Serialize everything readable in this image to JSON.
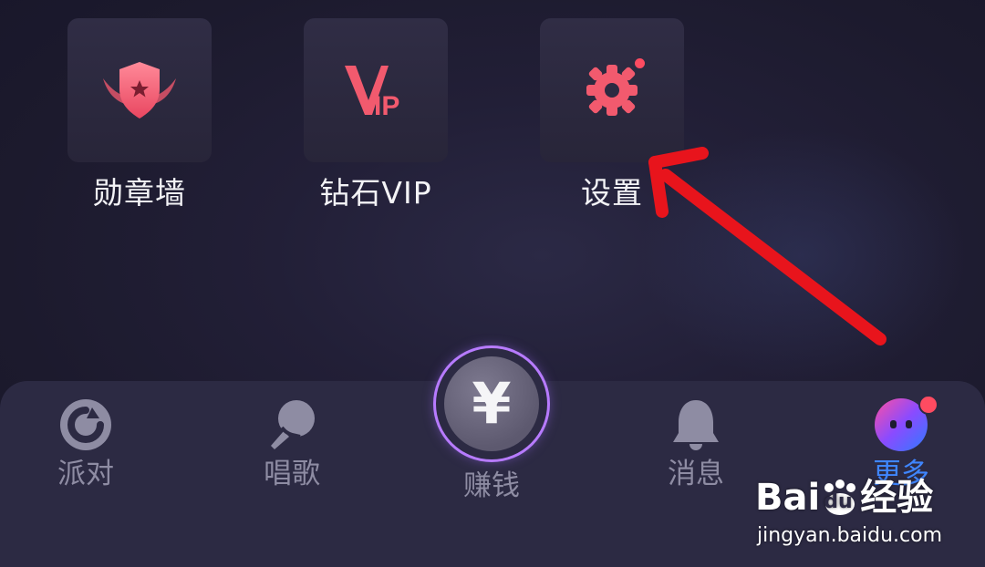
{
  "features": [
    {
      "label": "勋章墙",
      "icon": "medal-shield-icon"
    },
    {
      "label": "钻石VIP",
      "icon": "vip-icon",
      "icon_text_v": "V",
      "icon_text_ip": "IP"
    },
    {
      "label": "设置",
      "icon": "gear-icon",
      "badge": true
    }
  ],
  "tabs": [
    {
      "label": "派对",
      "icon": "party-icon"
    },
    {
      "label": "唱歌",
      "icon": "microphone-icon"
    },
    {
      "label": "赚钱",
      "icon": "yuan-icon",
      "symbol": "¥"
    },
    {
      "label": "消息",
      "icon": "bell-icon"
    },
    {
      "label": "更多",
      "icon": "more-face-icon",
      "badge": true
    }
  ],
  "watermark": {
    "brand_prefix": "Bai",
    "brand_mid": "du",
    "brand_suffix": "经验",
    "url": "jingyan.baidu.com"
  },
  "colors": {
    "accent_pink": "#f25a6e",
    "badge_red": "#ff4b61",
    "annotation_red": "#e8141c",
    "tab_inactive": "#8e8ca3",
    "tab_more": "#3f86ff",
    "earn_ring": "#b77bff"
  }
}
